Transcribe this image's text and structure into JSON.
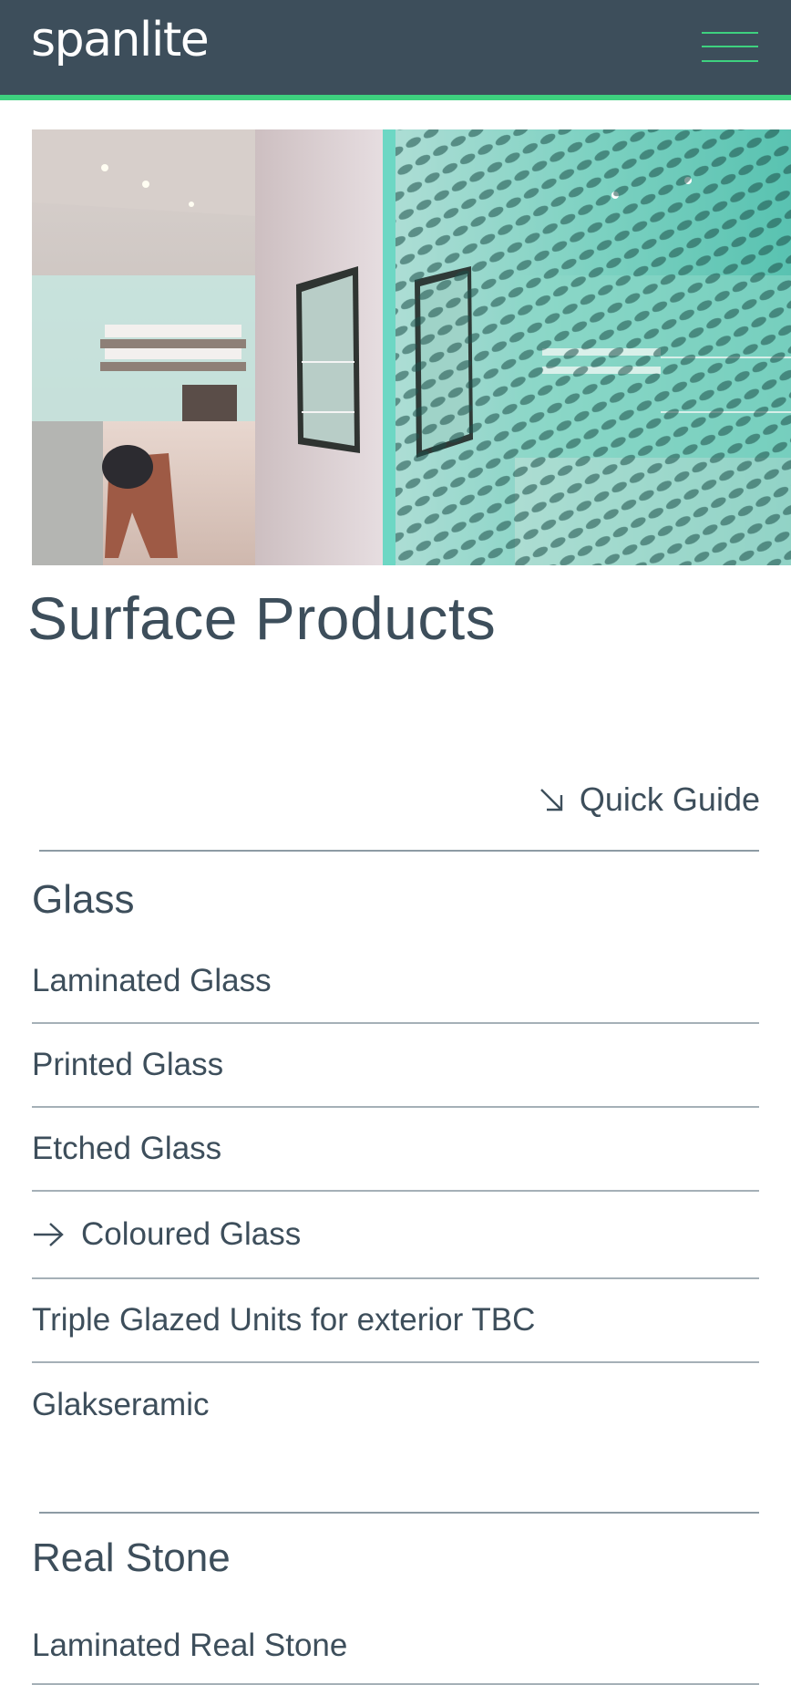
{
  "header": {
    "logo": "spanlite",
    "menu_icon": "hamburger-menu-icon",
    "background_color": "#3d4e5b",
    "accent_color": "#3ed17f"
  },
  "hero": {
    "image": "glass-wall-interior-photo"
  },
  "page": {
    "title": "Surface Products"
  },
  "quick_guide": {
    "icon": "arrow-down-right-icon",
    "label": "Quick Guide"
  },
  "sections": [
    {
      "heading": "Glass",
      "items": [
        {
          "label": "Laminated Glass"
        },
        {
          "label": "Printed Glass"
        },
        {
          "label": "Etched Glass"
        },
        {
          "label": "Coloured Glass",
          "icon": "arrow-right-icon"
        },
        {
          "label": "Triple Glazed Units for exterior TBC"
        },
        {
          "label": "Glakseramic"
        }
      ]
    },
    {
      "heading": "Real Stone",
      "items": [
        {
          "label": "Laminated Real Stone"
        }
      ]
    }
  ]
}
